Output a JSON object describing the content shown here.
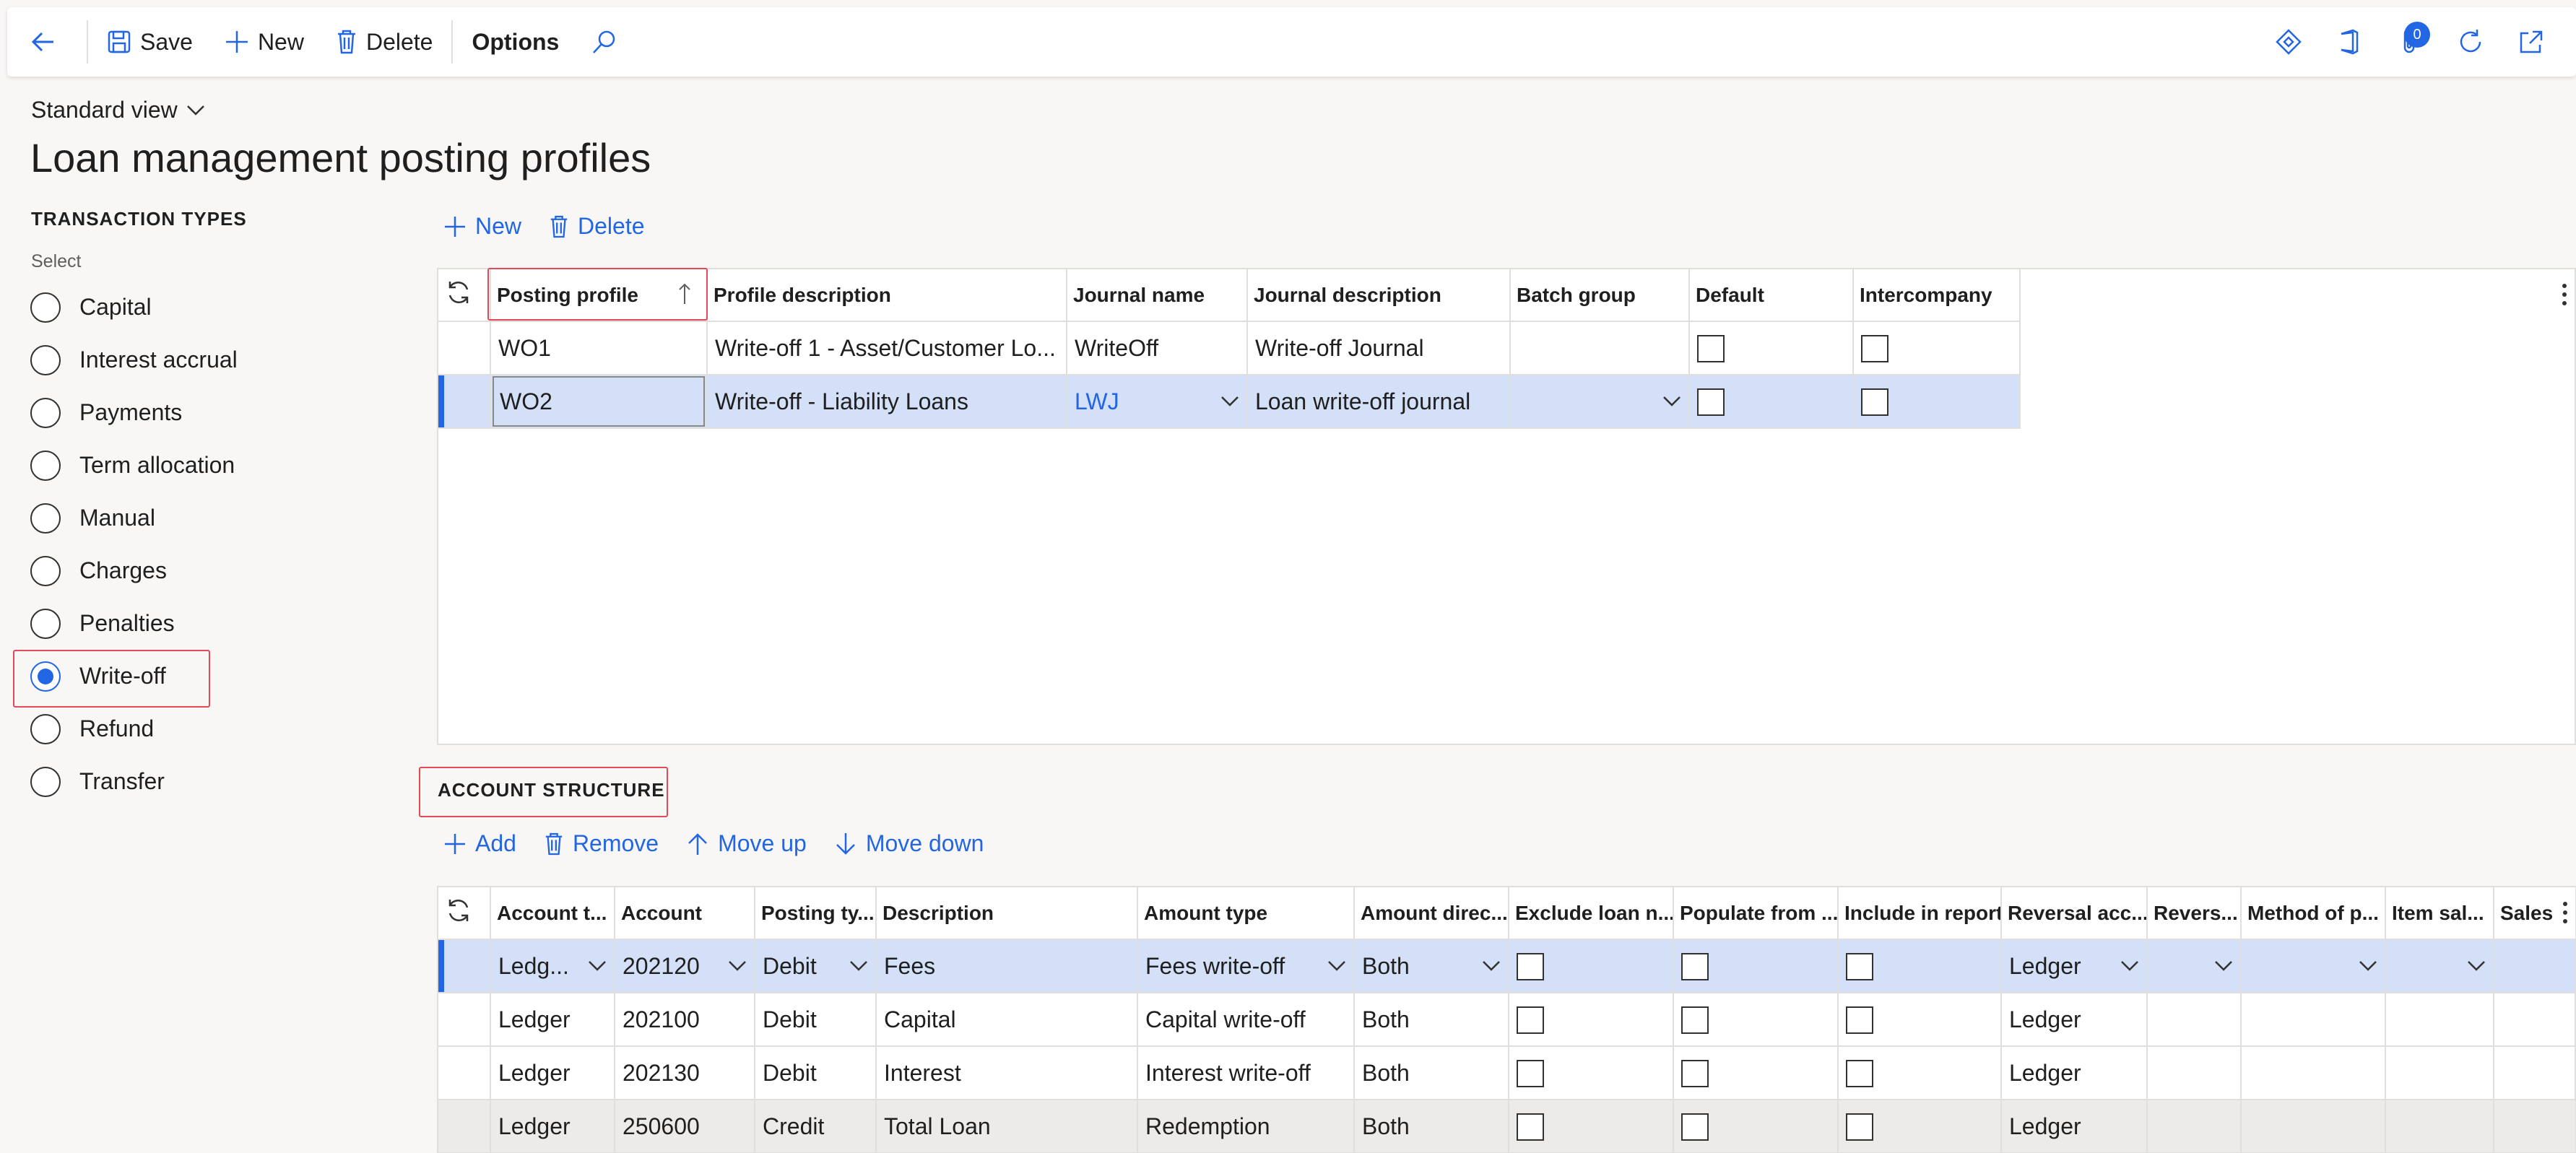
{
  "toolbar": {
    "save_label": "Save",
    "new_label": "New",
    "delete_label": "Delete",
    "options_label": "Options",
    "notifications_count": "0"
  },
  "header": {
    "view_label": "Standard view",
    "title": "Loan management posting profiles"
  },
  "transaction_types": {
    "heading": "TRANSACTION TYPES",
    "select_label": "Select",
    "items": [
      {
        "label": "Capital",
        "selected": false
      },
      {
        "label": "Interest accrual",
        "selected": false
      },
      {
        "label": "Payments",
        "selected": false
      },
      {
        "label": "Term allocation",
        "selected": false
      },
      {
        "label": "Manual",
        "selected": false
      },
      {
        "label": "Charges",
        "selected": false
      },
      {
        "label": "Penalties",
        "selected": false
      },
      {
        "label": "Write-off",
        "selected": true
      },
      {
        "label": "Refund",
        "selected": false
      },
      {
        "label": "Transfer",
        "selected": false
      }
    ]
  },
  "profiles_toolbar": {
    "new_label": "New",
    "delete_label": "Delete"
  },
  "profiles_grid": {
    "columns": [
      "Posting profile",
      "Profile description",
      "Journal name",
      "Journal description",
      "Batch group",
      "Default",
      "Intercompany"
    ],
    "rows": [
      {
        "posting_profile": "WO1",
        "profile_description": "Write-off 1 - Asset/Customer Lo...",
        "journal_name": "WriteOff",
        "journal_description": "Write-off Journal",
        "batch_group": "",
        "default": false,
        "intercompany": false
      },
      {
        "posting_profile": "WO2",
        "profile_description": "Write-off - Liability Loans",
        "journal_name": "LWJ",
        "journal_description": "Loan write-off journal",
        "batch_group": "",
        "default": false,
        "intercompany": false
      }
    ]
  },
  "account_structure": {
    "title": "ACCOUNT STRUCTURE",
    "add_label": "Add",
    "remove_label": "Remove",
    "move_up_label": "Move up",
    "move_down_label": "Move down",
    "columns": [
      "Account t...",
      "Account",
      "Posting ty...",
      "Description",
      "Amount type",
      "Amount direc...",
      "Exclude loan n...",
      "Populate from ...",
      "Include in report",
      "Reversal acc...",
      "Revers...",
      "Method of p...",
      "Item sal...",
      "Sales"
    ],
    "rows": [
      {
        "account_type": "Ledg...",
        "account": "202120",
        "posting_type": "Debit",
        "description": "Fees",
        "amount_type": "Fees write-off",
        "amount_direction": "Both",
        "reversal_account": "Ledger"
      },
      {
        "account_type": "Ledger",
        "account": "202100",
        "posting_type": "Debit",
        "description": "Capital",
        "amount_type": "Capital write-off",
        "amount_direction": "Both",
        "reversal_account": "Ledger"
      },
      {
        "account_type": "Ledger",
        "account": "202130",
        "posting_type": "Debit",
        "description": "Interest",
        "amount_type": "Interest write-off",
        "amount_direction": "Both",
        "reversal_account": "Ledger"
      },
      {
        "account_type": "Ledger",
        "account": "250600",
        "posting_type": "Credit",
        "description": "Total Loan",
        "amount_type": "Redemption",
        "amount_direction": "Both",
        "reversal_account": "Ledger"
      }
    ]
  },
  "colors": {
    "accent": "#2266e3",
    "selected_row": "#d3e0f7",
    "focus_outline": "#e34a55"
  }
}
